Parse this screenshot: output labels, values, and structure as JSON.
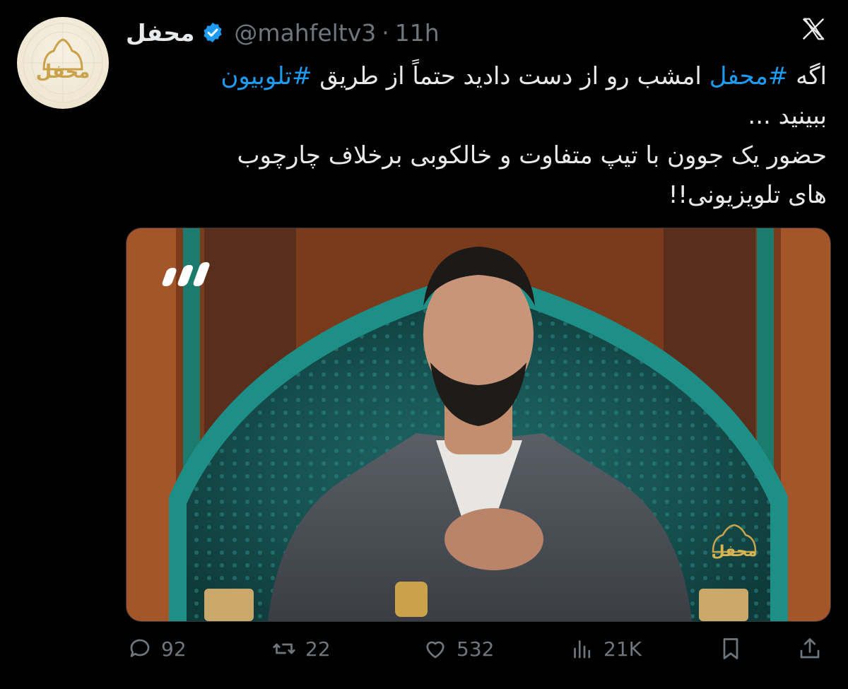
{
  "tweet": {
    "display_name": "محفل",
    "handle": "@mahfeltv3",
    "separator": "·",
    "time": "11h",
    "text": {
      "line1_prefix": "اگه",
      "hashtag1": "#محفل",
      "line1_middle": "امشب رو از دست دادید حتماً از طریق",
      "hashtag2": "#تلوبیون",
      "line2": "ببینید ...",
      "line3": "حضور یک جوون با تیپ متفاوت و خالکوبی برخلاف چارچوب",
      "line4": "های تلویزیونی!!"
    }
  },
  "avatar": {
    "logo_text": "محفل"
  },
  "media": {
    "watermark_text": "محفل",
    "channel_logo": "channel-3-logo"
  },
  "actions": {
    "replies": "92",
    "reposts": "22",
    "likes": "532",
    "views": "21K"
  },
  "icons": {
    "verified": "verified-badge-icon",
    "platform": "x-logo-icon",
    "reply": "reply-icon",
    "repost": "repost-icon",
    "like": "heart-icon",
    "views": "views-icon",
    "bookmark": "bookmark-icon",
    "share": "share-icon"
  },
  "colors": {
    "background": "#000000",
    "text": "#e7e9ea",
    "secondary": "#71767b",
    "accent": "#1d9bf0",
    "logo_gold": "#c9a24a"
  }
}
